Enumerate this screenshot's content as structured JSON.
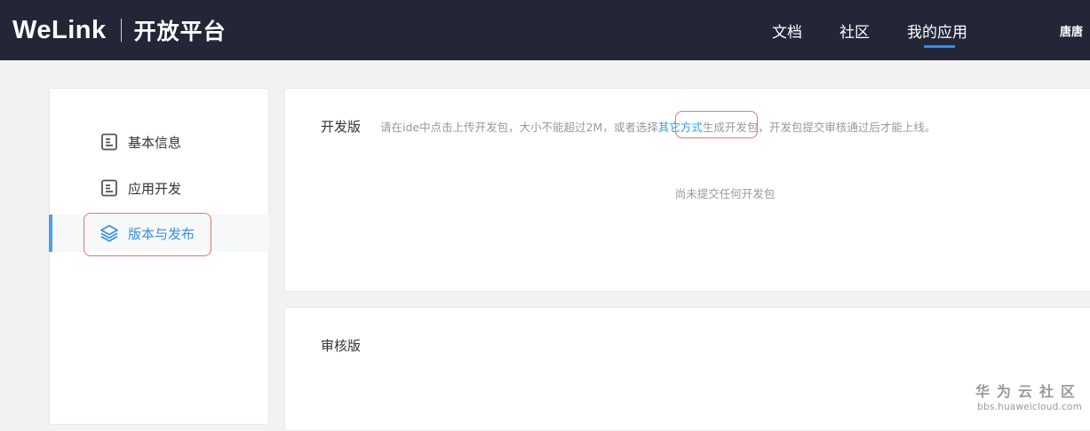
{
  "header": {
    "logo": "WeLink",
    "subtitle": "开放平台",
    "nav": [
      {
        "label": "文档"
      },
      {
        "label": "社区"
      },
      {
        "label": "我的应用"
      }
    ],
    "active_nav": "我的应用",
    "user_name": "唐唐",
    "accent_color": "#2f8cf3",
    "background_color": "#232637"
  },
  "sidebar": {
    "items": [
      {
        "label": "基本信息",
        "icon": "document-icon"
      },
      {
        "label": "应用开发",
        "icon": "document-icon"
      },
      {
        "label": "版本与发布",
        "icon": "layers-icon"
      }
    ],
    "active_item": "版本与发布"
  },
  "dev_card": {
    "title": "开发版",
    "hint_before": "请在ide中点击上传开发包，大小不能超过2M，或者选择",
    "hint_link": "其它方式",
    "hint_after": "生成开发包，开发包提交审核通过后才能上线。",
    "empty": "尚未提交任何开发包"
  },
  "review_card": {
    "title": "审核版"
  },
  "watermark": {
    "main": "华为云社区",
    "sub": "bbs.huaweicloud.com"
  }
}
